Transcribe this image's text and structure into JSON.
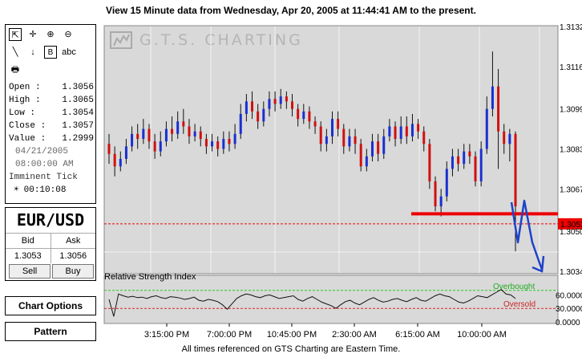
{
  "header": {
    "title": "View 15 Minute  data from Wednesday, Apr 20, 2005 at 11:44:41 AM to the present."
  },
  "toolbar": {
    "tools": [
      {
        "name": "pointer-tool",
        "glyph": "⇱"
      },
      {
        "name": "crosshair-tool",
        "glyph": "✛"
      },
      {
        "name": "zoom-in-tool",
        "glyph": "⊕"
      },
      {
        "name": "zoom-out-tool",
        "glyph": "⊖"
      },
      {
        "name": "line-tool",
        "glyph": "╲"
      },
      {
        "name": "arrow-tool",
        "glyph": "↓"
      },
      {
        "name": "text-box-tool",
        "glyph": "B"
      },
      {
        "name": "text-tool",
        "glyph": "abc"
      },
      {
        "name": "print-tool",
        "glyph": "🖶"
      }
    ]
  },
  "quote": {
    "open_label": "Open",
    "open": "1.3056",
    "high_label": "High",
    "high": "1.3065",
    "low_label": "Low",
    "low": "1.3054",
    "close_label": "Close",
    "close": "1.3057",
    "value_label": "Value",
    "value": "1.2999",
    "date": "04/21/2005",
    "time": "08:00:00 AM",
    "imminent_label": "Imminent Tick",
    "imminent_time": "00:10:08"
  },
  "pair": {
    "name": "EUR/USD",
    "bid_label": "Bid",
    "ask_label": "Ask",
    "bid": "1.3053",
    "ask": "1.3056",
    "sell_label": "Sell",
    "buy_label": "Buy"
  },
  "buttons": {
    "chart_options": "Chart Options",
    "pattern": "Pattern"
  },
  "watermark": "G.T.S. CHARTING",
  "footer": "All times referenced on GTS Charting are Eastern Time.",
  "chart_data": {
    "type": "candlestick",
    "y_ticks": [
      "1.3132",
      "1.3116",
      "1.3099",
      "1.3083",
      "1.3067",
      "1.3050",
      "1.3034"
    ],
    "ylim": [
      1.3034,
      1.3132
    ],
    "x_ticks": [
      "3:15:00 PM",
      "7:00:00 PM",
      "10:45:00 PM",
      "2:30:00 AM",
      "6:15:00 AM",
      "10:00:00 AM"
    ],
    "current_price_label": "1.3053",
    "current_price": 1.3053,
    "support_line": 1.3057,
    "colors": {
      "up": "#1a2fd0",
      "down": "#d01010",
      "bg": "#d9d9d9",
      "annotation": "#1f43c8",
      "line": "#ee0000"
    },
    "candles": [
      [
        1.3085,
        1.3081,
        1.3089,
        1.3077
      ],
      [
        1.3081,
        1.3076,
        1.3084,
        1.3072
      ],
      [
        1.3076,
        1.3079,
        1.3082,
        1.3074
      ],
      [
        1.3079,
        1.3084,
        1.3087,
        1.3077
      ],
      [
        1.3084,
        1.3089,
        1.3092,
        1.3082
      ],
      [
        1.3089,
        1.3087,
        1.3093,
        1.3083
      ],
      [
        1.3087,
        1.3091,
        1.3095,
        1.3085
      ],
      [
        1.3091,
        1.3086,
        1.3093,
        1.3083
      ],
      [
        1.3086,
        1.3082,
        1.3089,
        1.3079
      ],
      [
        1.3082,
        1.3086,
        1.309,
        1.308
      ],
      [
        1.3086,
        1.3091,
        1.3094,
        1.3084
      ],
      [
        1.3091,
        1.3089,
        1.3096,
        1.3086
      ],
      [
        1.3089,
        1.3094,
        1.3098,
        1.3087
      ],
      [
        1.3094,
        1.3092,
        1.3099,
        1.3089
      ],
      [
        1.3092,
        1.3088,
        1.3095,
        1.3085
      ],
      [
        1.3088,
        1.309,
        1.3093,
        1.3086
      ],
      [
        1.309,
        1.3087,
        1.3092,
        1.3084
      ],
      [
        1.3087,
        1.3084,
        1.3089,
        1.3081
      ],
      [
        1.3084,
        1.3086,
        1.3089,
        1.3082
      ],
      [
        1.3086,
        1.3083,
        1.3088,
        1.308
      ],
      [
        1.3083,
        1.3087,
        1.309,
        1.3081
      ],
      [
        1.3087,
        1.3085,
        1.309,
        1.3082
      ],
      [
        1.3085,
        1.3089,
        1.3093,
        1.3083
      ],
      [
        1.3089,
        1.3097,
        1.3101,
        1.3087
      ],
      [
        1.3097,
        1.3102,
        1.3105,
        1.3094
      ],
      [
        1.3102,
        1.3098,
        1.3106,
        1.3095
      ],
      [
        1.3098,
        1.3094,
        1.3101,
        1.3091
      ],
      [
        1.3094,
        1.3099,
        1.3102,
        1.3092
      ],
      [
        1.3099,
        1.3103,
        1.3106,
        1.3096
      ],
      [
        1.3103,
        1.3101,
        1.3106,
        1.3098
      ],
      [
        1.3101,
        1.3104,
        1.3107,
        1.3099
      ],
      [
        1.3104,
        1.3102,
        1.3106,
        1.3099
      ],
      [
        1.3102,
        1.3099,
        1.3105,
        1.3096
      ],
      [
        1.3099,
        1.3095,
        1.3101,
        1.3092
      ],
      [
        1.3095,
        1.3098,
        1.3101,
        1.3093
      ],
      [
        1.3098,
        1.3094,
        1.31,
        1.3091
      ],
      [
        1.3094,
        1.3092,
        1.3096,
        1.3089
      ],
      [
        1.3092,
        1.3085,
        1.3094,
        1.3082
      ],
      [
        1.3085,
        1.3088,
        1.3091,
        1.3082
      ],
      [
        1.3088,
        1.3095,
        1.3098,
        1.3085
      ],
      [
        1.3095,
        1.3091,
        1.3098,
        1.3088
      ],
      [
        1.3091,
        1.3084,
        1.3093,
        1.3081
      ],
      [
        1.3084,
        1.3088,
        1.3091,
        1.3082
      ],
      [
        1.3088,
        1.3085,
        1.3091,
        1.3081
      ],
      [
        1.3085,
        1.3076,
        1.3087,
        1.3074
      ],
      [
        1.3076,
        1.308,
        1.3083,
        1.3074
      ],
      [
        1.308,
        1.3086,
        1.3089,
        1.3078
      ],
      [
        1.3086,
        1.3081,
        1.3089,
        1.3078
      ],
      [
        1.3081,
        1.3088,
        1.3091,
        1.3079
      ],
      [
        1.3088,
        1.3092,
        1.3095,
        1.3086
      ],
      [
        1.3092,
        1.3087,
        1.3094,
        1.3084
      ],
      [
        1.3087,
        1.3092,
        1.3096,
        1.3085
      ],
      [
        1.3092,
        1.3088,
        1.3096,
        1.3085
      ],
      [
        1.3088,
        1.3093,
        1.3097,
        1.3086
      ],
      [
        1.3093,
        1.309,
        1.3095,
        1.3087
      ],
      [
        1.309,
        1.3085,
        1.3092,
        1.3082
      ],
      [
        1.3085,
        1.307,
        1.3087,
        1.3067
      ],
      [
        1.307,
        1.306,
        1.3072,
        1.3058
      ],
      [
        1.306,
        1.3064,
        1.3067,
        1.3056
      ],
      [
        1.3064,
        1.3075,
        1.3078,
        1.3062
      ],
      [
        1.3075,
        1.308,
        1.3083,
        1.3072
      ],
      [
        1.308,
        1.3077,
        1.3083,
        1.3074
      ],
      [
        1.3077,
        1.3082,
        1.3085,
        1.3075
      ],
      [
        1.3082,
        1.308,
        1.3085,
        1.3077
      ],
      [
        1.308,
        1.307,
        1.3082,
        1.3068
      ],
      [
        1.307,
        1.3083,
        1.3086,
        1.3068
      ],
      [
        1.3083,
        1.3099,
        1.3104,
        1.3081
      ],
      [
        1.3099,
        1.3108,
        1.3122,
        1.3096
      ],
      [
        1.3108,
        1.309,
        1.3115,
        1.3075
      ],
      [
        1.309,
        1.3085,
        1.3093,
        1.3081
      ],
      [
        1.3085,
        1.3089,
        1.3091,
        1.3078
      ],
      [
        1.3089,
        1.306,
        1.309,
        1.3042
      ]
    ],
    "rsi": {
      "title": "Relative Strength Index",
      "overbought_label": "Overbought",
      "oversold_label": "Oversold",
      "overbought": 70,
      "oversold": 30,
      "ticks": [
        "60.0000",
        "30.0000",
        "0.0000"
      ],
      "values": [
        50,
        12,
        62,
        58,
        55,
        57,
        54,
        55,
        52,
        56,
        58,
        54,
        52,
        56,
        55,
        53,
        50,
        52,
        55,
        48,
        46,
        50,
        48,
        45,
        38,
        28,
        40,
        52,
        58,
        62,
        60,
        56,
        54,
        58,
        60,
        56,
        52,
        54,
        56,
        58,
        50,
        46,
        52,
        56,
        50,
        44,
        40,
        36,
        30,
        38,
        45,
        48,
        42,
        38,
        44,
        50,
        54,
        48,
        44,
        46,
        50,
        52,
        48,
        45,
        50,
        54,
        48,
        46,
        52,
        58,
        62,
        58,
        56,
        50,
        44,
        42,
        46,
        52,
        58,
        56,
        54,
        60,
        66,
        72,
        62,
        60,
        52
      ]
    }
  }
}
